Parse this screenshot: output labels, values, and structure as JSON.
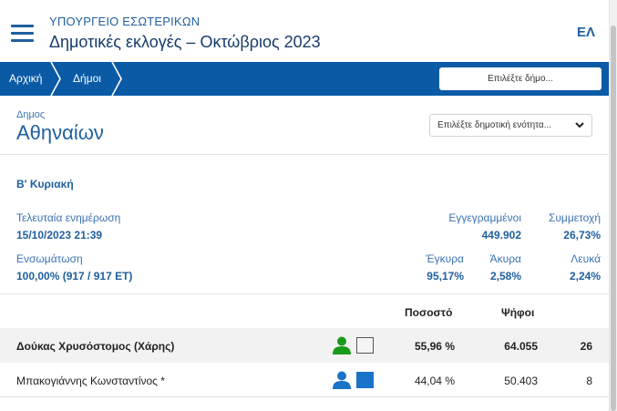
{
  "header": {
    "ministry": "ΥΠΟΥΡΓΕΙΟ ΕΣΩΤΕΡΙΚΩΝ",
    "title": "Δημοτικές εκλογές – Οκτώβριος 2023",
    "lang": "ΕΛ"
  },
  "breadcrumb": {
    "home": "Αρχική",
    "municipalities": "Δήμοι",
    "select_municipality": "Επιλέξτε δήμο..."
  },
  "municipality": {
    "label": "Δημος",
    "name": "Αθηναίων",
    "unit_select": "Επιλέξτε δημοτική ενότητα..."
  },
  "round": "Β' Κυριακή",
  "stats": {
    "last_update_label": "Τελευταία ενημέρωση",
    "last_update_value": "15/10/2023 21:39",
    "registered_label": "Εγγεγραμμένοι",
    "registered_value": "449.902",
    "turnout_label": "Συμμετοχή",
    "turnout_value": "26,73%",
    "integration_label": "Ενσωμάτωση",
    "integration_value": "100,00% (917 / 917 ΕΤ)",
    "valid_label": "Έγκυρα",
    "valid_value": "95,17%",
    "invalid_label": "Άκυρα",
    "invalid_value": "2,58%",
    "blank_label": "Λευκά",
    "blank_value": "2,24%"
  },
  "results": {
    "col_percent": "Ποσοστό",
    "col_votes": "Ψήφοι",
    "candidates": [
      {
        "name": "Δούκας Χρυσόστομος (Χάρης)",
        "percent": "55,96 %",
        "votes": "64.055",
        "seats": "26",
        "icon_color": "#1a9a1a",
        "box_color": "#f4f4f4",
        "box_border": "#555555"
      },
      {
        "name": "Μπακογιάννης Κωνσταντίνος *",
        "percent": "44,04 %",
        "votes": "50.403",
        "seats": "8",
        "icon_color": "#1a73c8",
        "box_color": "#1a73c8",
        "box_border": "#1a73c8"
      }
    ]
  },
  "colors": {
    "brand_blue": "#0b5aa6",
    "text_blue": "#1f5f9f",
    "label_blue": "#3b73b3"
  }
}
